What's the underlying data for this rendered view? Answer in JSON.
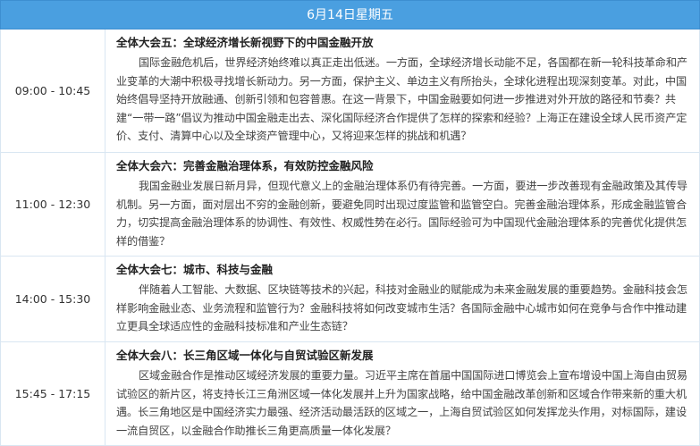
{
  "day_header": "6月14日星期五",
  "sessions": [
    {
      "time": "09:00 - 10:45",
      "title": "全体大会五：全球经济增长新视野下的中国金融开放",
      "description": "国际金融危机后，世界经济始终难以真正走出低迷。一方面，全球经济增长动能不足，各国都在新一轮科技革命和产业变革的大潮中积极寻找增长新动力。另一方面，保护主义、单边主义有所抬头，全球化进程出现深刻变革。对此，中国始终倡导坚持开放融通、创新引领和包容普惠。在这一背景下，中国金融要如何进一步推进对外开放的路径和节奏？共建“一带一路”倡议为推动中国金融走出去、深化国际经济合作提供了怎样的探索和经验？上海正在建设全球人民币资产定价、支付、清算中心以及全球资产管理中心，又将迎来怎样的挑战和机遇？"
    },
    {
      "time": "11:00 - 12:30",
      "title": "全体大会六：完善金融治理体系，有效防控金融风险",
      "description": "我国金融业发展日新月异，但现代意义上的金融治理体系仍有待完善。一方面，要进一步改善现有金融政策及其传导机制。另一方面，面对层出不穷的金融创新，要避免同时出现过度监管和监管空白。完善金融治理体系，形成金融监管合力，切实提高金融治理体系的协调性、有效性、权威性势在必行。国际经验可为中国现代金融治理体系的完善优化提供怎样的借鉴？"
    },
    {
      "time": "14:00 - 15:30",
      "title": "全体大会七：城市、科技与金融",
      "description": "伴随着人工智能、大数据、区块链等技术的兴起，科技对金融业的赋能成为未来金融发展的重要趋势。金融科技会怎样影响金融业态、业务流程和监管行为？金融科技将如何改变城市生活？各国际金融中心城市如何在竞争与合作中推动建立更具全球适应性的金融科技标准和产业生态链？"
    },
    {
      "time": "15:45 - 17:15",
      "title": "全体大会八：长三角区域一体化与自贸试验区新发展",
      "description": "区域金融合作是推动区域经济发展的重要力量。习近平主席在首届中国国际进口博览会上宣布增设中国上海自由贸易试验区的新片区，将支持长江三角洲区域一体化发展并上升为国家战略，给中国金融改革创新和区域合作带来新的重大机遇。长三角地区是中国经济实力最强、经济活动最活跃的区域之一，上海自贸试验区如何发挥龙头作用，对标国际，建设一流自贸区，以金融合作助推长三角更高质量一体化发展？"
    }
  ]
}
